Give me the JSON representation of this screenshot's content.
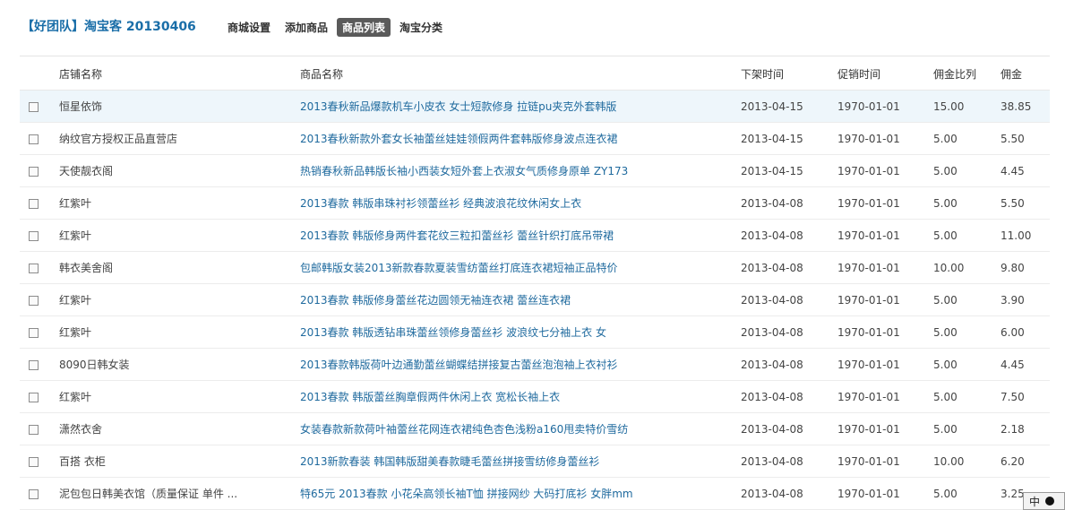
{
  "header": {
    "brand": "【好团队】淘宝客 20130406",
    "nav": [
      {
        "label": "商城设置",
        "active": false
      },
      {
        "label": "添加商品",
        "active": false
      },
      {
        "label": "商品列表",
        "active": true
      },
      {
        "label": "淘宝分类",
        "active": false
      }
    ]
  },
  "table": {
    "columns": [
      "店铺名称",
      "商品名称",
      "下架时间",
      "促销时间",
      "佣金比列",
      "佣金"
    ],
    "rows": [
      {
        "shop": "恒星依饰",
        "product": "2013春秋新品爆款机车小皮衣 女士短款修身 拉链pu夹克外套韩版",
        "down_time": "2013-04-15",
        "promo_time": "1970-01-01",
        "rate": "15.00",
        "commission": "38.85",
        "highlight": true
      },
      {
        "shop": "纳纹官方授权正品直营店",
        "product": "2013春秋新款外套女长袖蕾丝娃娃领假两件套韩版修身波点连衣裙",
        "down_time": "2013-04-15",
        "promo_time": "1970-01-01",
        "rate": "5.00",
        "commission": "5.50"
      },
      {
        "shop": "天使靓衣阁",
        "product": "热销春秋新品韩版长袖小西装女短外套上衣淑女气质修身原单 ZY173",
        "down_time": "2013-04-15",
        "promo_time": "1970-01-01",
        "rate": "5.00",
        "commission": "4.45"
      },
      {
        "shop": "红紫叶",
        "product": "2013春款 韩版串珠衬衫领蕾丝衫 经典波浪花纹休闲女上衣",
        "down_time": "2013-04-08",
        "promo_time": "1970-01-01",
        "rate": "5.00",
        "commission": "5.50"
      },
      {
        "shop": "红紫叶",
        "product": "2013春款 韩版修身两件套花纹三粒扣蕾丝衫 蕾丝针织打底吊带裙",
        "down_time": "2013-04-08",
        "promo_time": "1970-01-01",
        "rate": "5.00",
        "commission": "11.00"
      },
      {
        "shop": "韩衣美舍阁",
        "product": "包邮韩版女装2013新款春款夏装雪纺蕾丝打底连衣裙短袖正品特价",
        "down_time": "2013-04-08",
        "promo_time": "1970-01-01",
        "rate": "10.00",
        "commission": "9.80"
      },
      {
        "shop": "红紫叶",
        "product": "2013春款 韩版修身蕾丝花边圆领无袖连衣裙 蕾丝连衣裙",
        "down_time": "2013-04-08",
        "promo_time": "1970-01-01",
        "rate": "5.00",
        "commission": "3.90"
      },
      {
        "shop": "红紫叶",
        "product": "2013春款 韩版透钻串珠蕾丝领修身蕾丝衫 波浪纹七分袖上衣 女",
        "down_time": "2013-04-08",
        "promo_time": "1970-01-01",
        "rate": "5.00",
        "commission": "6.00"
      },
      {
        "shop": "8090日韩女装",
        "product": "2013春款韩版荷叶边通勤蕾丝蝴蝶结拼接复古蕾丝泡泡袖上衣衬衫",
        "down_time": "2013-04-08",
        "promo_time": "1970-01-01",
        "rate": "5.00",
        "commission": "4.45"
      },
      {
        "shop": "红紫叶",
        "product": "2013春款 韩版蕾丝胸章假两件休闲上衣 宽松长袖上衣",
        "down_time": "2013-04-08",
        "promo_time": "1970-01-01",
        "rate": "5.00",
        "commission": "7.50"
      },
      {
        "shop": "潇然衣舍",
        "product": "女装春款新款荷叶袖蕾丝花网连衣裙纯色杏色浅粉a160甩卖特价雪纺",
        "down_time": "2013-04-08",
        "promo_time": "1970-01-01",
        "rate": "5.00",
        "commission": "2.18"
      },
      {
        "shop": "百搭 衣柜",
        "product": "2013新款春装 韩国韩版甜美春款睫毛蕾丝拼接雪纺修身蕾丝衫",
        "down_time": "2013-04-08",
        "promo_time": "1970-01-01",
        "rate": "10.00",
        "commission": "6.20"
      },
      {
        "shop": "泥包包日韩美衣馆（质量保证 单件 ...",
        "product": "特65元 2013春款 小花朵高领长袖T恤 拼接网纱 大码打底衫 女胖mm",
        "down_time": "2013-04-08",
        "promo_time": "1970-01-01",
        "rate": "5.00",
        "commission": "3.25"
      }
    ]
  },
  "ime": {
    "label": "中"
  }
}
